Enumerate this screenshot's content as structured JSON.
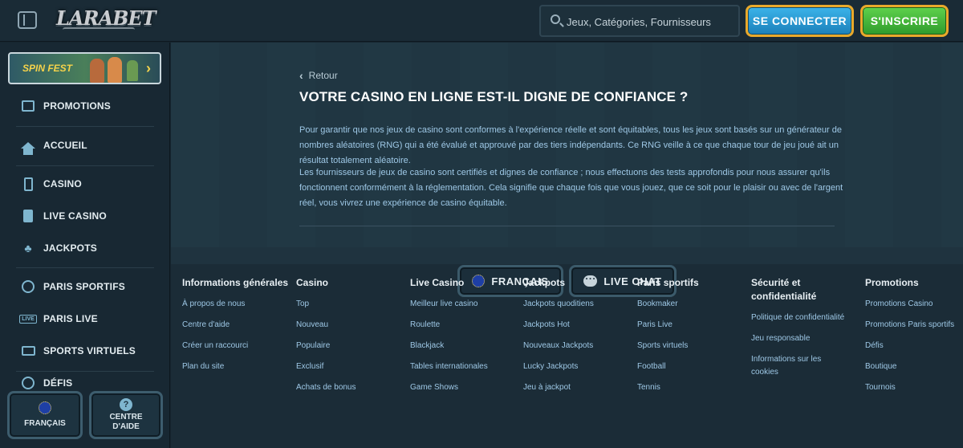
{
  "header": {
    "logo_text": "LARABET",
    "search_placeholder": "Jeux, Catégories, Fournisseurs",
    "login_label": "SE CONNECTER",
    "register_label": "S'INSCRIRE"
  },
  "sidebar": {
    "promo_banner": "SPIN FEST",
    "items": [
      {
        "label": "PROMOTIONS",
        "icon": "gift-icon"
      },
      {
        "label": "ACCUEIL",
        "icon": "home-icon"
      },
      {
        "label": "CASINO",
        "icon": "slot-machine-icon"
      },
      {
        "label": "LIVE CASINO",
        "icon": "card-icon"
      },
      {
        "label": "JACKPOTS",
        "icon": "clover-icon"
      },
      {
        "label": "PARIS SPORTIFS",
        "icon": "basketball-icon"
      },
      {
        "label": "PARIS LIVE",
        "icon": "live-icon"
      },
      {
        "label": "SPORTS VIRTUELS",
        "icon": "screen-icon"
      },
      {
        "label": "DÉFIS",
        "icon": "target-icon"
      }
    ],
    "bottom_lang": "FRANÇAIS",
    "bottom_help_line1": "CENTRE",
    "bottom_help_line2": "D'AIDE"
  },
  "article": {
    "back_label": "Retour",
    "title": "VOTRE CASINO EN LIGNE EST-IL DIGNE DE CONFIANCE  ?",
    "paragraph1": "Pour garantir que nos jeux de casino sont conformes à l'expérience réelle et sont équitables, tous les jeux sont basés sur un générateur de nombres aléatoires (RNG) qui a été évalué et approuvé par des tiers indépendants. Ce RNG veille à ce que chaque tour de jeu joué ait un résultat totalement aléatoire.",
    "paragraph2": "Les fournisseurs de jeux de casino sont certifiés et dignes de confiance ; nous effectuons des tests approfondis pour nous assurer qu'ils fonctionnent conformément à la réglementation. Cela signifie que chaque fois que vous jouez, que ce soit pour le plaisir ou avec de l'argent réel, vous vivrez une expérience de casino équitable."
  },
  "footer": {
    "lang_label": "FRANÇAIS",
    "chat_label": "LIVE CHAT",
    "columns": [
      {
        "head": "Informations générales",
        "links": [
          "À propos de nous",
          "Centre d'aide",
          "Créer un raccourci",
          "Plan du site"
        ]
      },
      {
        "head": "Casino",
        "links": [
          "Top",
          "Nouveau",
          "Populaire",
          "Exclusif",
          "Achats de bonus"
        ]
      },
      {
        "head": "Live Casino",
        "links": [
          "Meilleur live casino",
          "Roulette",
          "Blackjack",
          "Tables internationales",
          "Game Shows"
        ]
      },
      {
        "head": "Jackpots",
        "links": [
          "Jackpots quoditiens",
          "Jackpots Hot",
          "Nouveaux Jackpots",
          "Lucky Jackpots",
          "Jeu à jackpot"
        ]
      },
      {
        "head": "Paris sportifs",
        "links": [
          "Bookmaker",
          "Paris Live",
          "Sports virtuels",
          "Football",
          "Tennis"
        ]
      },
      {
        "head": "Sécurité et confidentialité",
        "links": [
          "Politique de confidentialité",
          "Jeu responsable",
          "Informations sur les cookies"
        ]
      },
      {
        "head": "Promotions",
        "links": [
          "Promotions Casino",
          "Promotions Paris sportifs",
          "Défis",
          "Boutique",
          "Tournois"
        ]
      }
    ]
  },
  "colors": {
    "accent_blue": "#2a9bd6",
    "accent_green": "#3fb535",
    "border_gold": "#e9a92b",
    "text_link": "#9ec8e6"
  }
}
